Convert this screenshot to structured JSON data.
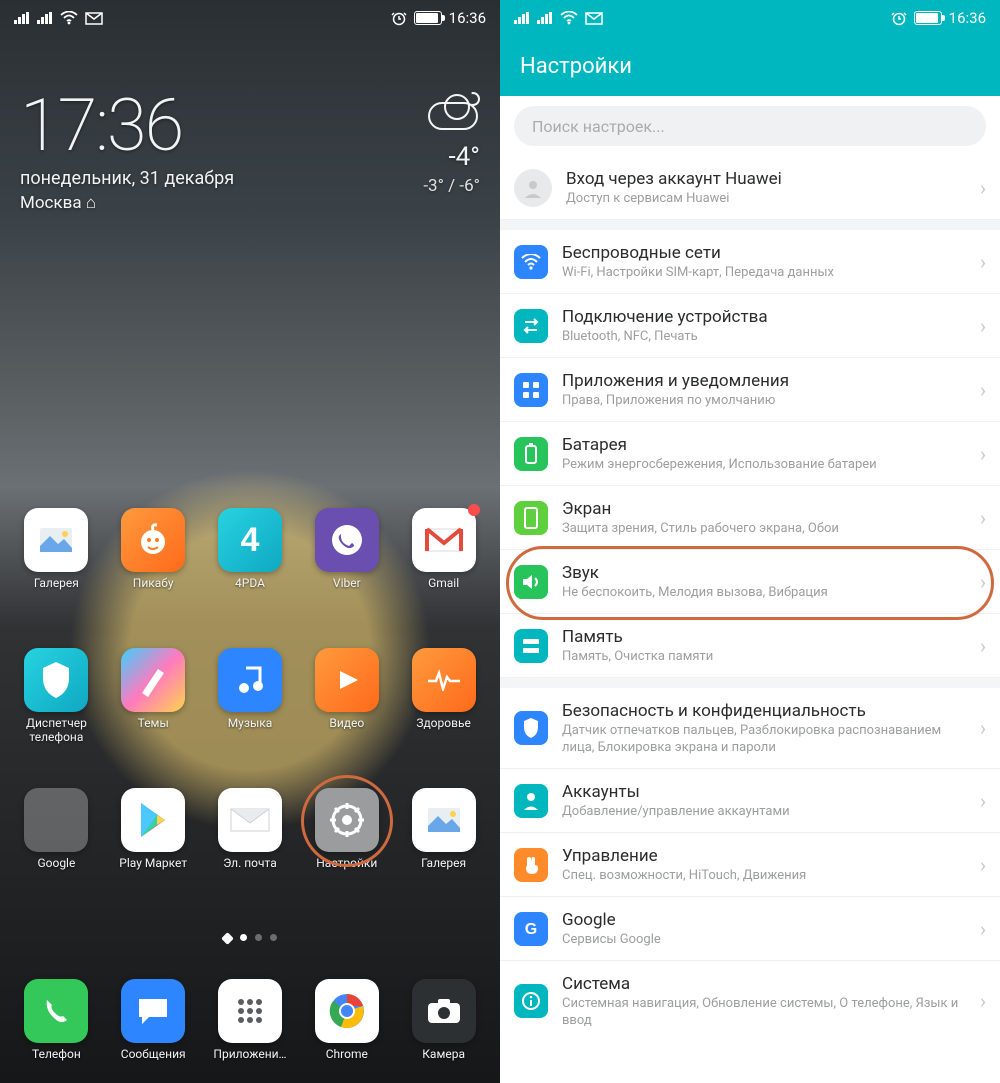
{
  "status": {
    "time": "16:36"
  },
  "home": {
    "clock": "17:36",
    "date": "понедельник, 31 декабря",
    "city": "Москва ⌂",
    "temp_now": "-4°",
    "temp_range": "-3° / -6°",
    "apps_row1": [
      {
        "label": "Галерея"
      },
      {
        "label": "Пикабу"
      },
      {
        "label": "4PDA"
      },
      {
        "label": "Viber"
      },
      {
        "label": "Gmail"
      }
    ],
    "apps_row2": [
      {
        "label": "Диспетчер телефона"
      },
      {
        "label": "Темы"
      },
      {
        "label": "Музыка"
      },
      {
        "label": "Видео"
      },
      {
        "label": "Здоровье"
      }
    ],
    "apps_row3": [
      {
        "label": "Google"
      },
      {
        "label": "Play Маркет"
      },
      {
        "label": "Эл. почта"
      },
      {
        "label": "Настройки"
      },
      {
        "label": "Галерея"
      }
    ],
    "dock": [
      {
        "label": "Телефон"
      },
      {
        "label": "Сообщения"
      },
      {
        "label": "Приложени…"
      },
      {
        "label": "Chrome"
      },
      {
        "label": "Камера"
      }
    ]
  },
  "settings": {
    "header": "Настройки",
    "search_placeholder": "Поиск настроек...",
    "account": {
      "title": "Вход через аккаунт Huawei",
      "sub": "Доступ к сервисам Huawei"
    },
    "items": [
      {
        "title": "Беспроводные сети",
        "sub": "Wi-Fi, Настройки SIM-карт, Передача данных",
        "color": "ic-blue",
        "glyph": "wifi"
      },
      {
        "title": "Подключение устройства",
        "sub": "Bluetooth, NFC, Печать",
        "color": "ic-teal",
        "glyph": "swap"
      },
      {
        "title": "Приложения и уведомления",
        "sub": "Права, Приложения по умолчанию",
        "color": "ic-blue",
        "glyph": "grid"
      },
      {
        "title": "Батарея",
        "sub": "Режим энергосбережения, Использование батареи",
        "color": "ic-green",
        "glyph": "batt"
      },
      {
        "title": "Экран",
        "sub": "Защита зрения, Стиль рабочего экрана, Обои",
        "color": "ic-lime",
        "glyph": "screen"
      },
      {
        "title": "Звук",
        "sub": "Не беспокоить, Мелодия вызова, Вибрация",
        "color": "ic-green",
        "glyph": "sound"
      },
      {
        "title": "Память",
        "sub": "Память, Очистка памяти",
        "color": "ic-teal",
        "glyph": "storage"
      },
      {
        "title": "Безопасность и конфиденциальность",
        "sub": "Датчик отпечатков пальцев, Разблокировка распознаванием лица, Блокировка экрана и пароли",
        "color": "ic-blue",
        "glyph": "shield"
      },
      {
        "title": "Аккаунты",
        "sub": "Добавление/управление аккаунтами",
        "color": "ic-teal",
        "glyph": "user"
      },
      {
        "title": "Управление",
        "sub": "Спец. возможности, HiTouch, Движения",
        "color": "ic-orange",
        "glyph": "hand"
      },
      {
        "title": "Google",
        "sub": "Сервисы Google",
        "color": "ic-blue",
        "glyph": "g"
      },
      {
        "title": "Система",
        "sub": "Системная навигация, Обновление системы, О телефоне, Язык и ввод",
        "color": "ic-teal",
        "glyph": "info"
      }
    ]
  }
}
